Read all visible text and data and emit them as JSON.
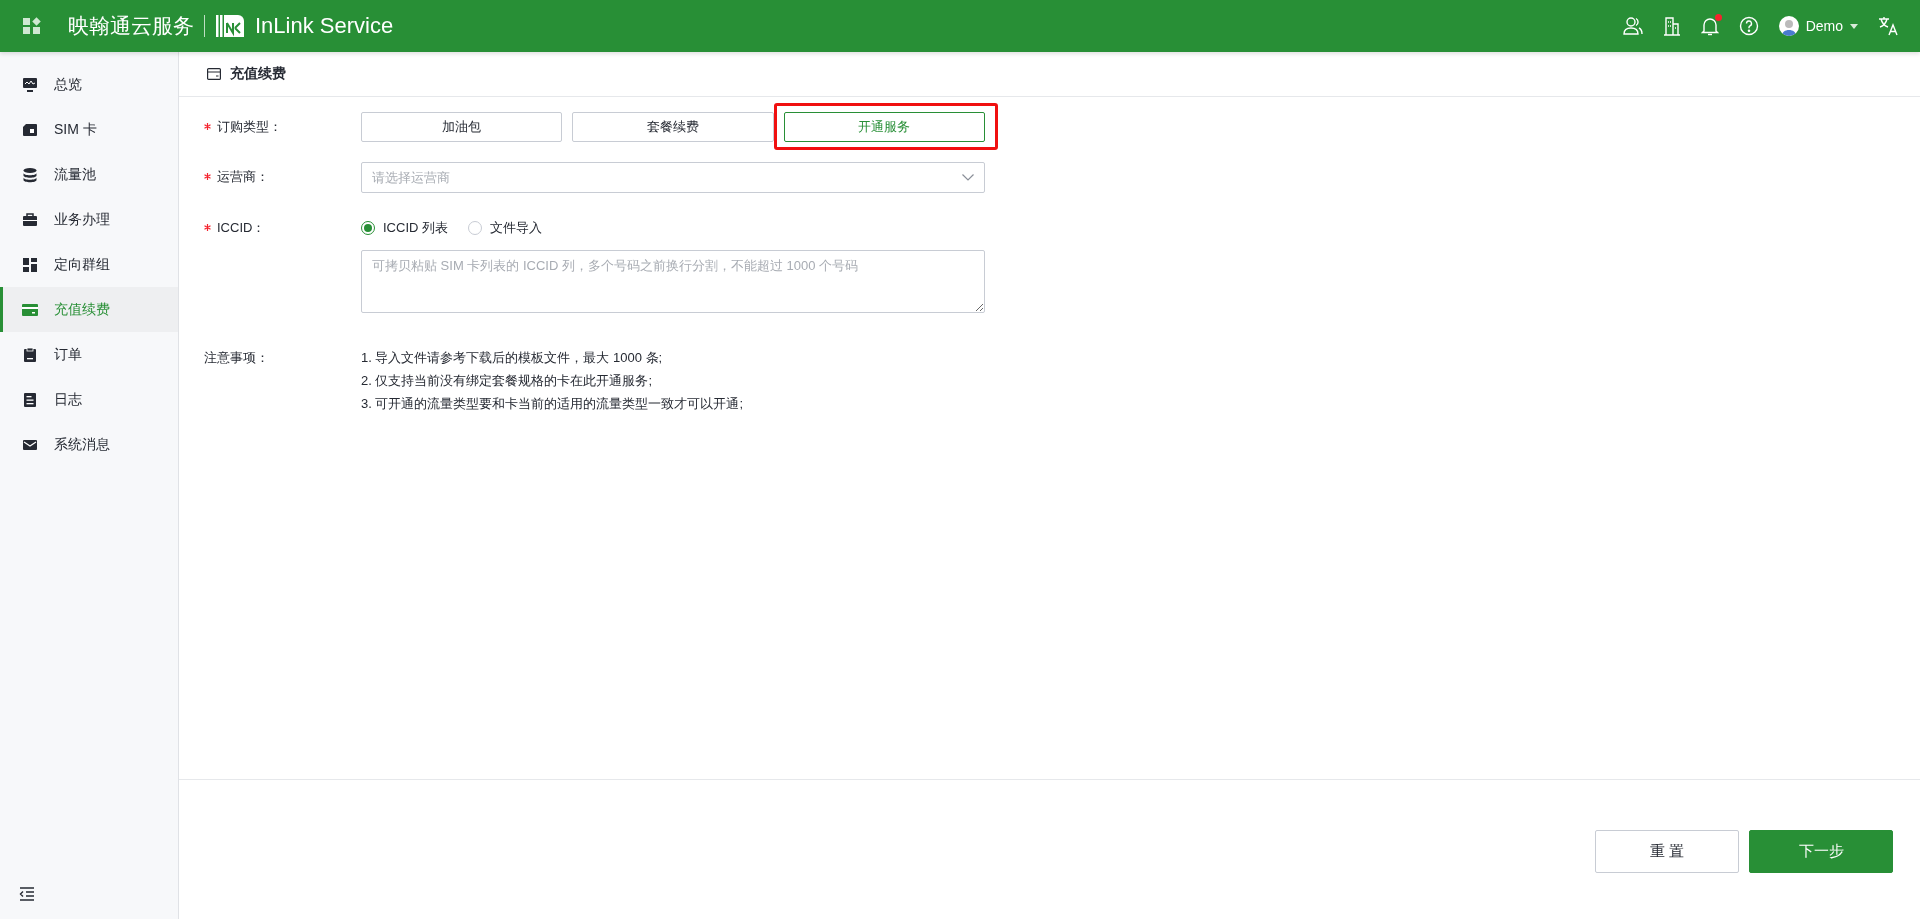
{
  "header": {
    "brand_cn": "映翰通云服务",
    "brand_en": "InLink Service",
    "notifications_unread": true,
    "user": "Demo"
  },
  "sidebar": {
    "items": [
      {
        "label": "总览",
        "selected": false
      },
      {
        "label": "SIM 卡",
        "selected": false
      },
      {
        "label": "流量池",
        "selected": false
      },
      {
        "label": "业务办理",
        "selected": false
      },
      {
        "label": "定向群组",
        "selected": false
      },
      {
        "label": "充值续费",
        "selected": true
      },
      {
        "label": "订单",
        "selected": false
      },
      {
        "label": "日志",
        "selected": false
      },
      {
        "label": "系统消息",
        "selected": false
      }
    ]
  },
  "page_title": "充值续费",
  "form": {
    "order_type": {
      "label": "订购类型：",
      "required": true,
      "options": [
        {
          "label": "加油包",
          "selected": false,
          "highlighted": false
        },
        {
          "label": "套餐续费",
          "selected": false,
          "highlighted": false
        },
        {
          "label": "开通服务",
          "selected": true,
          "highlighted": true
        }
      ]
    },
    "carrier": {
      "label": "运营商：",
      "required": true,
      "placeholder": "请选择运营商"
    },
    "iccid": {
      "label": "ICCID：",
      "required": true,
      "sources": [
        {
          "label": "ICCID 列表",
          "selected": true
        },
        {
          "label": "文件导入",
          "selected": false
        }
      ],
      "placeholder": "可拷贝粘贴 SIM 卡列表的 ICCID 列，多个号码之前换行分割，不能超过 1000 个号码"
    },
    "notes": {
      "label": "注意事项：",
      "lines": [
        "1. 导入文件请参考下载后的模板文件，最大 1000 条;",
        "2. 仅支持当前没有绑定套餐规格的卡在此开通服务;",
        "3. 可开通的流量类型要和卡当前的适用的流量类型一致才可以开通;"
      ]
    }
  },
  "actions": [
    {
      "label": "重 置",
      "kind": "secondary"
    },
    {
      "label": "下一步",
      "kind": "primary"
    }
  ]
}
